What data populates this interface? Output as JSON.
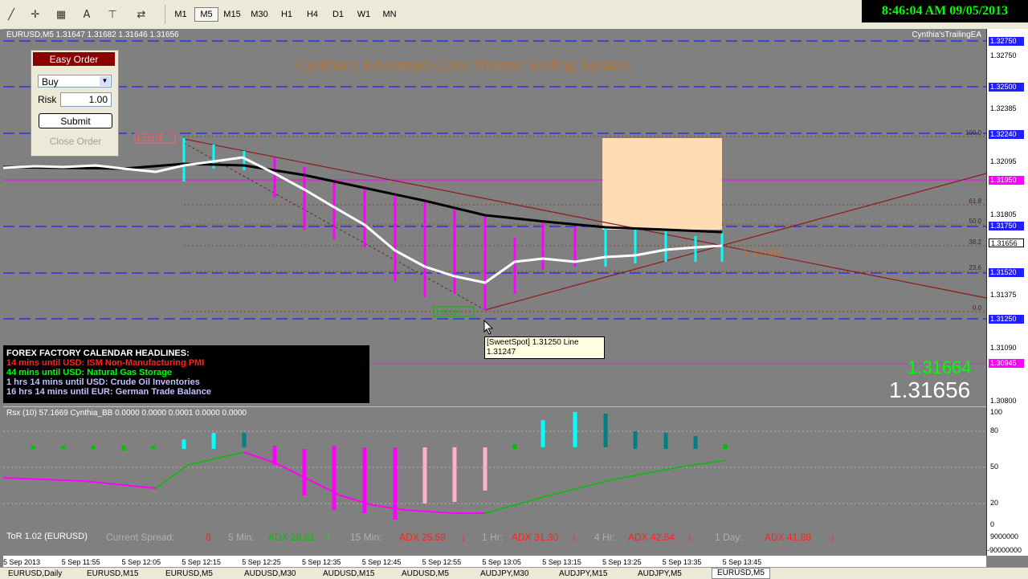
{
  "toolbar": {
    "timeframes": [
      "M1",
      "M5",
      "M15",
      "M30",
      "H1",
      "H4",
      "D1",
      "W1",
      "MN"
    ],
    "active_timeframe": "M5",
    "icons": [
      "line-tool-icon",
      "crosshair-icon",
      "grid-icon",
      "text-icon",
      "text-label-icon",
      "arrows-icon"
    ]
  },
  "clock": "8:46:04 AM 09/05/2013",
  "chart": {
    "title": "EURUSD,M5  1.31647 1.31682 1.31646 1.31656",
    "ea_label": "Cynthia'sTrailingEA",
    "system_title": "Cynthia's Advanced Color Ribbon Surfing System",
    "price_big": "1.31656",
    "price_green": "1.31664",
    "fib_levels": [
      "100.0",
      "61.8",
      "50.0",
      "38.2",
      "23.6",
      "0.0"
    ],
    "chart_labels": [
      "1.32276",
      "1.31247",
      "1.31655",
      "1.31137"
    ]
  },
  "y_axis": {
    "ticks": [
      "1.32750",
      "1.32576",
      "1.32500",
      "1.32385",
      "1.32240",
      "1.32095",
      "1.31950",
      "1.31805",
      "1.31750",
      "1.31656",
      "1.31520",
      "1.31375",
      "1.31250",
      "1.31090",
      "1.30945",
      "1.30800"
    ],
    "rsi_ticks": [
      "100",
      "80",
      "50",
      "20",
      "0",
      "9000000",
      "-90000000"
    ]
  },
  "easy_order": {
    "title": "Easy Order",
    "side": "Buy",
    "risk_label": "Risk",
    "risk_value": "1.00",
    "submit": "Submit",
    "close": "Close Order"
  },
  "calendar": {
    "heading": "FOREX FACTORY CALENDAR HEADLINES:",
    "items": [
      {
        "text": "14 mins until USD: ISM Non-Manufacturing PMI",
        "color": "#ff2020"
      },
      {
        "text": "44 mins until USD: Natural Gas Storage",
        "color": "#00ff00"
      },
      {
        "text": "1 hrs 14 mins until USD: Crude Oil Inventories",
        "color": "#c0c0ff"
      },
      {
        "text": "16 hrs 14 mins until EUR: German Trade Balance",
        "color": "#c0c0ff"
      }
    ]
  },
  "tooltip": {
    "line1": "[SweetSpot] 1.31250 Line",
    "line2": "1.31247"
  },
  "rsi": {
    "label": "Rsx (10) 57.1669  Cynthia_BB 0.0000 0.0000 0.0001 0.0000 0.0000"
  },
  "tor": {
    "name": "ToR 1.02 (EURUSD)",
    "spread_label": "Current Spread:",
    "spread_value": "8",
    "m5_label": "5 Min:",
    "m5_value": "ADX 26.81",
    "m15_label": "15 Min:",
    "m15_value": "ADX 25.59",
    "h1_label": "1 Hr:",
    "h1_value": "ADX 31.30",
    "h4_label": "4 Hr:",
    "h4_value": "ADX 42.54",
    "d1_label": "1 Day:",
    "d1_value": "ADX 41.88",
    "up_arrow": "↑",
    "down_arrow": "↓"
  },
  "x_axis": [
    "5 Sep 2013",
    "5 Sep 11:55",
    "5 Sep 12:05",
    "5 Sep 12:15",
    "5 Sep 12:25",
    "5 Sep 12:35",
    "5 Sep 12:45",
    "5 Sep 12:55",
    "5 Sep 13:05",
    "5 Sep 13:15",
    "5 Sep 13:25",
    "5 Sep 13:35",
    "5 Sep 13:45"
  ],
  "tabs": [
    "EURUSD,Daily",
    "EURUSD,M15",
    "EURUSD,M5",
    "AUDUSD,M30",
    "AUDUSD,M15",
    "AUDUSD,M5",
    "AUDJPY,M30",
    "AUDJPY,M15",
    "AUDJPY,M5",
    "EURUSD,M5"
  ],
  "active_tab_index": 9,
  "colors": {
    "chart_bg": "#808080",
    "bull": "#00ffff",
    "bear": "#ff00ff",
    "ribbon": "#ffffff",
    "ma_black": "#000000",
    "blue_lines": "#1e1ee6"
  }
}
